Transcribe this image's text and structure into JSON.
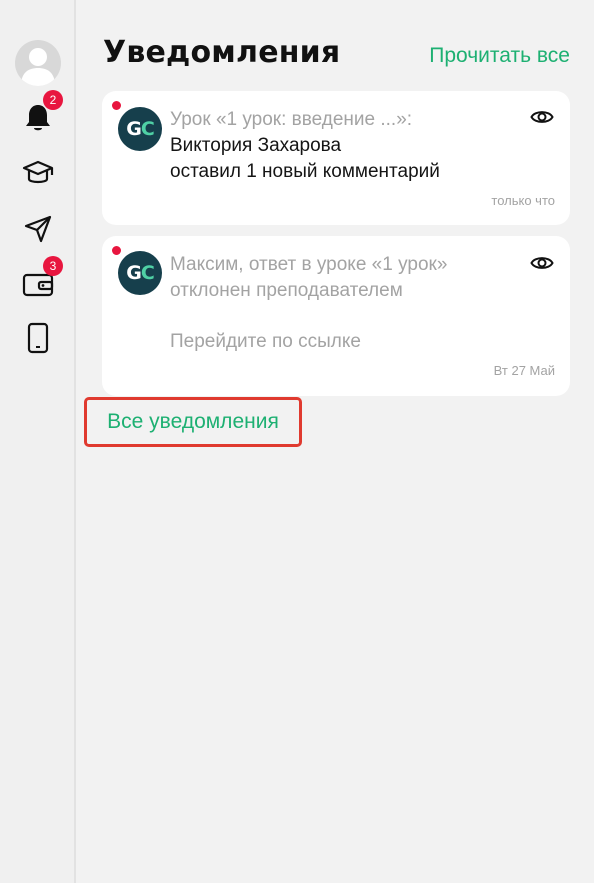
{
  "sidebar": {
    "notifications_badge": "2",
    "wallet_badge": "3"
  },
  "header": {
    "title": "Уведомления",
    "read_all": "Прочитать все"
  },
  "notifications": [
    {
      "logo_g": "G",
      "logo_c": "C",
      "line1": "Урок «1 урок: введение ...»:",
      "line2": "Виктория Захарова",
      "line3": "оставил 1 новый комментарий",
      "time": "только что"
    },
    {
      "logo_g": "G",
      "logo_c": "C",
      "line1": "Максим, ответ в уроке «1 урок»",
      "line2": "отклонен преподавателем",
      "line3": "Перейдите по ссылке",
      "time": "Вт 27 Май"
    }
  ],
  "all_notifications": "Все уведомления",
  "colors": {
    "accent": "#1db072",
    "badge": "#e8163f",
    "logo_bg": "#163f4c",
    "highlight_border": "#e03a2f"
  }
}
